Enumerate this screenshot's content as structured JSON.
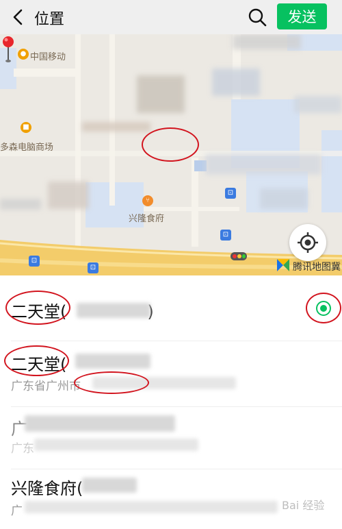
{
  "header": {
    "title": "位置",
    "send_label": "发送",
    "back_icon": "chevron-left-icon",
    "search_icon": "search-icon"
  },
  "map": {
    "labels": {
      "china_mobile": "中国移动",
      "duosen": "多森电脑商场",
      "xinglong": "兴隆食府"
    },
    "watermark": "腾讯地图",
    "watermark_partial": "冀"
  },
  "list": {
    "items": [
      {
        "name": "二天堂(",
        "suffix": ")",
        "address": "",
        "selected": true
      },
      {
        "name": "二天堂(",
        "suffix": ")",
        "address": "广东省广州市",
        "selected": false
      },
      {
        "name": "广",
        "suffix": "",
        "address": "广东",
        "selected": false
      },
      {
        "name": "兴隆食府(",
        "suffix": "",
        "address": "广",
        "selected": false
      }
    ]
  },
  "watermark_site": "Bai 经验",
  "colors": {
    "accent": "#07c160",
    "annotation": "#d2141e",
    "header_bg": "#efefef"
  }
}
